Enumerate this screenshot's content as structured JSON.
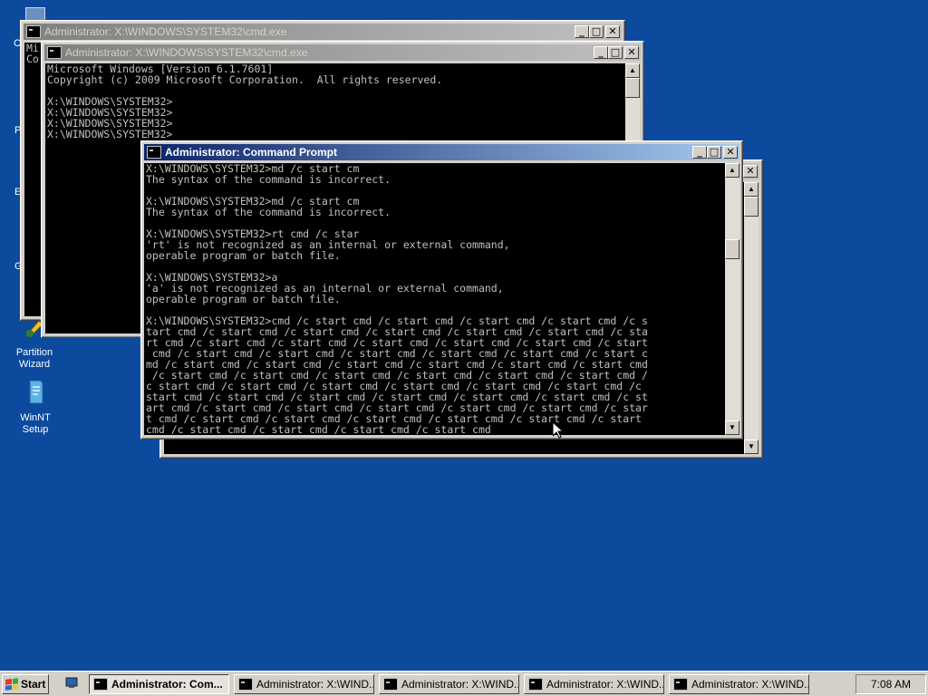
{
  "desktop": {
    "edge_glyphs": [
      "C",
      "P",
      "E",
      "G"
    ],
    "icons": [
      {
        "label_line1": "Partition",
        "label_line2": "Wizard",
        "icon": "partition-wizard-icon"
      },
      {
        "label_line1": "WinNT Setup",
        "label_line2": "",
        "icon": "winnt-setup-icon"
      }
    ]
  },
  "windows": {
    "back1": {
      "title": "Administrator: X:\\WINDOWS\\SYSTEM32\\cmd.exe",
      "visible_text": "Mi\nCo"
    },
    "back2": {
      "title": "Administrator: X:\\WINDOWS\\SYSTEM32\\cmd.exe",
      "console": "Microsoft Windows [Version 6.1.7601]\nCopyright (c) 2009 Microsoft Corporation.  All rights reserved.\n\nX:\\WINDOWS\\SYSTEM32>\nX:\\WINDOWS\\SYSTEM32>\nX:\\WINDOWS\\SYSTEM32>\nX:\\WINDOWS\\SYSTEM32>"
    },
    "front": {
      "title": "Administrator: Command Prompt",
      "console": "X:\\WINDOWS\\SYSTEM32>md /c start cm\nThe syntax of the command is incorrect.\n\nX:\\WINDOWS\\SYSTEM32>md /c start cm\nThe syntax of the command is incorrect.\n\nX:\\WINDOWS\\SYSTEM32>rt cmd /c star\n'rt' is not recognized as an internal or external command,\noperable program or batch file.\n\nX:\\WINDOWS\\SYSTEM32>a\n'a' is not recognized as an internal or external command,\noperable program or batch file.\n\nX:\\WINDOWS\\SYSTEM32>cmd /c start cmd /c start cmd /c start cmd /c start cmd /c s\ntart cmd /c start cmd /c start cmd /c start cmd /c start cmd /c start cmd /c sta\nrt cmd /c start cmd /c start cmd /c start cmd /c start cmd /c start cmd /c start\n cmd /c start cmd /c start cmd /c start cmd /c start cmd /c start cmd /c start c\nmd /c start cmd /c start cmd /c start cmd /c start cmd /c start cmd /c start cmd\n /c start cmd /c start cmd /c start cmd /c start cmd /c start cmd /c start cmd /\nc start cmd /c start cmd /c start cmd /c start cmd /c start cmd /c start cmd /c \nstart cmd /c start cmd /c start cmd /c start cmd /c start cmd /c start cmd /c st\nart cmd /c start cmd /c start cmd /c start cmd /c start cmd /c start cmd /c star\nt cmd /c start cmd /c start cmd /c start cmd /c start cmd /c start cmd /c start\ncmd /c start cmd /c start cmd /c start cmd /c start cmd_"
    }
  },
  "taskbar": {
    "start_label": "Start",
    "tasks": [
      {
        "label": "Administrator: Com...",
        "active": true
      },
      {
        "label": "Administrator: X:\\WIND...",
        "active": false
      },
      {
        "label": "Administrator: X:\\WIND...",
        "active": false
      },
      {
        "label": "Administrator: X:\\WIND...",
        "active": false
      },
      {
        "label": "Administrator: X:\\WIND...",
        "active": false
      }
    ],
    "clock": "7:08 AM"
  },
  "colors": {
    "desktop": "#0b4a9d",
    "active_title_start": "#0a246a",
    "active_title_end": "#a6caf0",
    "console_bg": "#000000",
    "console_fg": "#c0c0c0"
  }
}
